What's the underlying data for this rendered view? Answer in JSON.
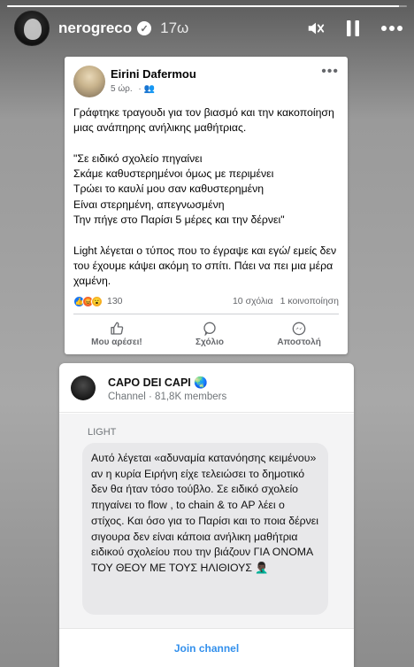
{
  "story": {
    "username": "nerogreco",
    "time": "17ω",
    "progress": 0.98,
    "verified_icon": "verified-badge-icon",
    "controls": [
      "mute-icon",
      "pause-icon",
      "more-icon"
    ]
  },
  "fb_post": {
    "author": "Eirini Dafermou",
    "time": "5 ώρ.",
    "audience_icon": "friends-icon",
    "body": "Γράφτηκε τραγουδι για τον βιασμό και την κακοποίηση μιας ανάπηρης ανήλικης μαθήτριας.\n\n\"Σε ειδικό σχολείο πηγαίνει\nΣκάμε καθυστερημένοι όμως με περιμένει\nΤρώει το καυλί μου σαν καθυστερημένη\nΕίναι στερημένη, απεγνωσμένη\nΤην πήγε στο Παρίσι 5 μέρες και την δέρνει\"\n\nLight λέγεται ο τύπος που το έγραψε και εγώ/ εμείς δεν του έχουμε κάψει ακόμη το σπίτι. Πάει να πει μια μέρα χαμένη.",
    "reactions_count": "130",
    "comments": "10 σχόλια",
    "shares": "1 κοινοποίηση",
    "actions": {
      "like": "Μου αρέσει!",
      "comment": "Σχόλιο",
      "send": "Αποστολή"
    },
    "colors": {
      "like": "#1877f2",
      "angry": "#f0643a",
      "wow": "#f7b125"
    }
  },
  "telegram": {
    "channel_name": "CAPO DEI CAPI 🌏",
    "subtitle": "Channel · 81,8K members",
    "sender": "LIGHT",
    "message": "Αυτό λέγεται «αδυναμία κατανόησης κειμένου» αν η κυρία Ειρήνη είχε τελειώσει το δημοτικό δεν θα ήταν τόσο τούβλο. Σε ειδικό σχολείο πηγαίνει το flow , to chain & το AP λέει ο στίχος. Και όσο για το Παρίσι και το ποια δέρνει σιγουρα δεν είναι κάποια ανήλικη μαθήτρια ειδικού σχολείου που την βιάζουν ΓΙΑ ΟΝΟΜΑ ΤΟΥ ΘΕΟΥ ΜΕ ΤΟΥΣ ΗΛΙΘΙΟΥΣ 🤦🏿‍♂️",
    "join_label": "Join channel",
    "accent": "#3390ec"
  }
}
